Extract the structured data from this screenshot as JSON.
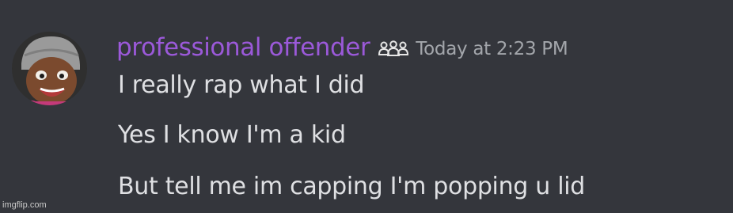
{
  "message": {
    "author": {
      "name": "professional offender",
      "name_color": "#9b59d9",
      "role_icon": "members-icon"
    },
    "timestamp": "Today at 2:23 PM",
    "lines": [
      "I really rap what I did",
      "Yes I know I'm a kid",
      "But tell me im capping I'm popping u lid"
    ]
  },
  "watermark": "imgflip.com",
  "colors": {
    "background": "#34363c",
    "message_text": "#dfe0e3",
    "timestamp_text": "#a3a6ab"
  }
}
